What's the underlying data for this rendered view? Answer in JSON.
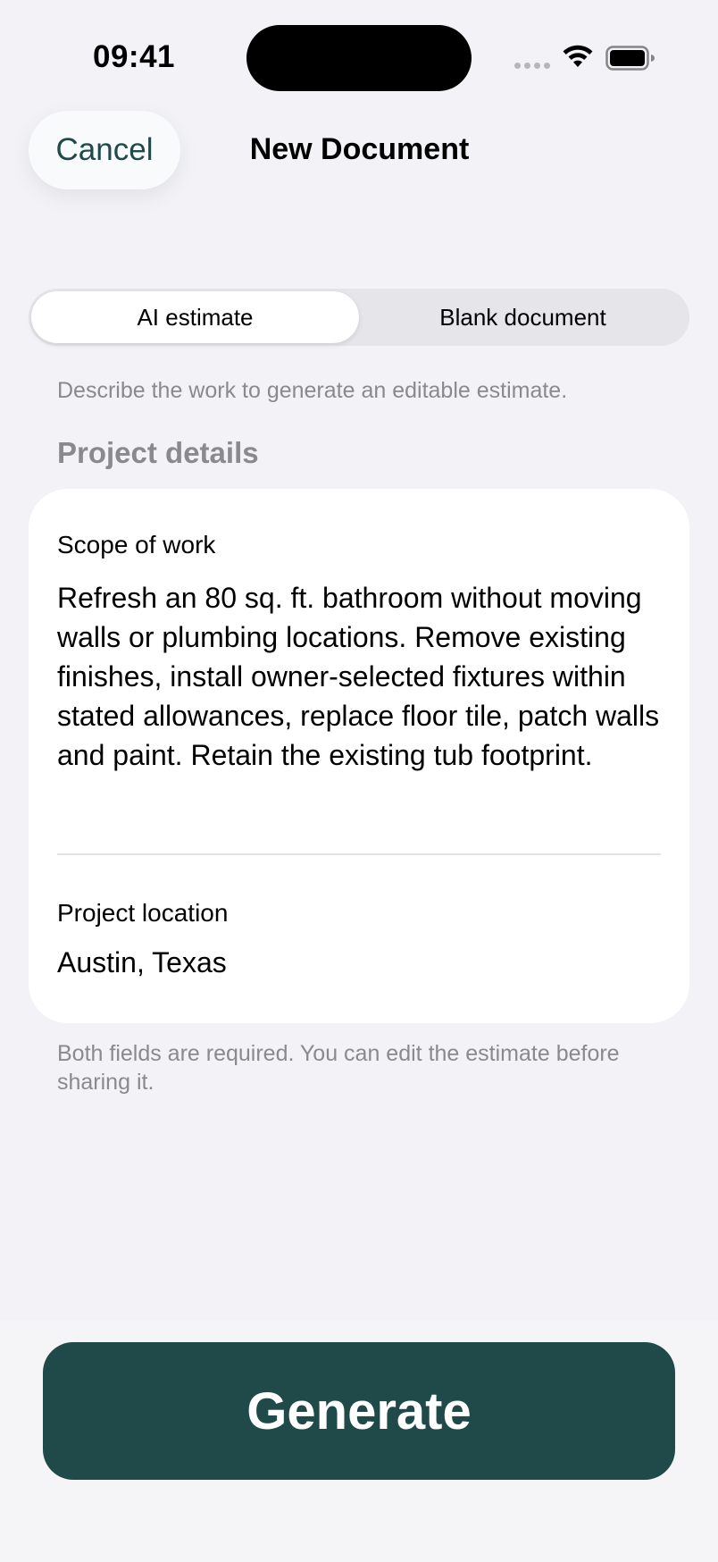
{
  "status_bar": {
    "time": "09:41",
    "icons": [
      "signal-dots-icon",
      "wifi-icon",
      "battery-icon"
    ]
  },
  "nav": {
    "cancel_label": "Cancel",
    "title": "New Document"
  },
  "segmented": {
    "options": [
      {
        "label": "AI estimate",
        "selected": true
      },
      {
        "label": "Blank document",
        "selected": false
      }
    ]
  },
  "hint": "Describe the work to generate an editable estimate.",
  "section_header": "Project details",
  "form": {
    "scope_label": "Scope of work",
    "scope_value": "Refresh an 80 sq. ft. bathroom without moving walls or plumbing locations. Remove existing finishes, install owner-selected fixtures within stated allowances, replace floor tile, patch walls and paint. Retain the existing tub footprint.",
    "location_label": "Project location",
    "location_value": "Austin, Texas"
  },
  "footnote": "Both fields are required. You can edit the estimate before sharing it.",
  "generate_label": "Generate",
  "colors": {
    "accent": "#1f4a49",
    "background": "#f2f2f7",
    "secondary_text": "#8a8a8e"
  }
}
